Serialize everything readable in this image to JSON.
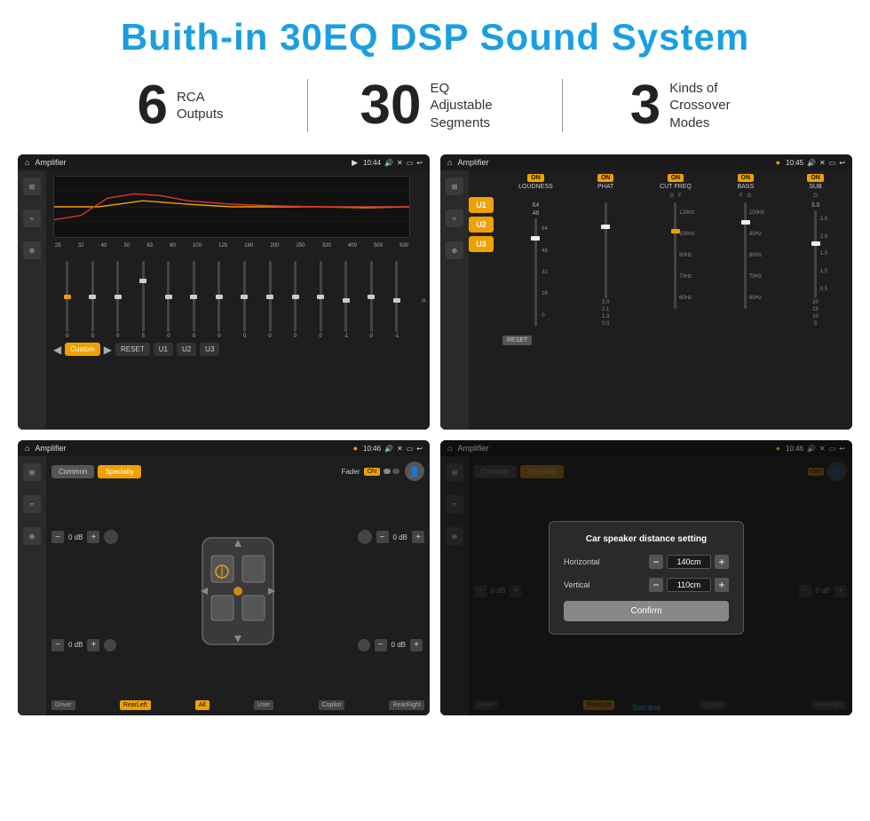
{
  "page": {
    "background": "#ffffff"
  },
  "header": {
    "title": "Buith-in 30EQ DSP Sound System"
  },
  "stats": [
    {
      "number": "6",
      "label": "RCA\nOutputs"
    },
    {
      "number": "30",
      "label": "EQ Adjustable\nSegments"
    },
    {
      "number": "3",
      "label": "Kinds of\nCrossover Modes"
    }
  ],
  "screens": [
    {
      "id": "screen-eq",
      "title": "Amplifier",
      "time": "10:44",
      "type": "eq",
      "frequencies": [
        "25",
        "32",
        "40",
        "50",
        "63",
        "80",
        "100",
        "125",
        "160",
        "200",
        "250",
        "320",
        "400",
        "500",
        "630"
      ],
      "values": [
        "0",
        "0",
        "0",
        "5",
        "0",
        "0",
        "0",
        "0",
        "0",
        "0",
        "0",
        "-1",
        "0",
        "-1"
      ],
      "buttons": [
        "Custom",
        "RESET",
        "U1",
        "U2",
        "U3"
      ]
    },
    {
      "id": "screen-amp",
      "title": "Amplifier",
      "time": "10:45",
      "type": "amplifier",
      "u_buttons": [
        "U1",
        "U2",
        "U3"
      ],
      "controls": [
        "LOUDNESS",
        "PHAT",
        "CUT FREQ",
        "BASS",
        "SUB"
      ],
      "reset_label": "RESET"
    },
    {
      "id": "screen-speaker",
      "title": "Amplifier",
      "time": "10:46",
      "type": "speaker",
      "top_buttons": [
        "Common",
        "Specialty"
      ],
      "fader_label": "Fader",
      "on_label": "ON",
      "db_values": [
        "0 dB",
        "0 dB",
        "0 dB",
        "0 dB"
      ],
      "bottom_buttons": [
        "Driver",
        "RearLeft",
        "All",
        "User",
        "Copilot",
        "RearRight"
      ]
    },
    {
      "id": "screen-dialog",
      "title": "Amplifier",
      "time": "10:46",
      "type": "dialog",
      "top_buttons": [
        "Common",
        "Specialty"
      ],
      "on_label": "ON",
      "dialog": {
        "title": "Car speaker distance setting",
        "horizontal_label": "Horizontal",
        "horizontal_value": "140cm",
        "vertical_label": "Vertical",
        "vertical_value": "110cm",
        "confirm_label": "Confirm"
      },
      "db_values": [
        "0 dB",
        "0 dB"
      ],
      "bottom_buttons": [
        "Driver",
        "RearLeft",
        "Copilot",
        "RearRight"
      ]
    }
  ]
}
